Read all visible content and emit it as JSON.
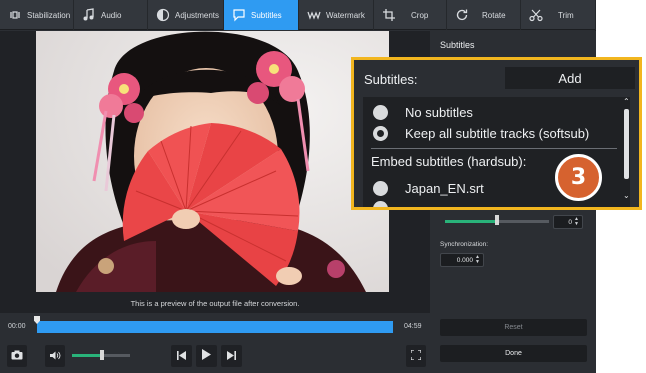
{
  "toolbar": {
    "tools": [
      {
        "label": "Stabilization",
        "icon": "stabilization-icon"
      },
      {
        "label": "Audio",
        "icon": "music-note-icon"
      },
      {
        "label": "Adjustments",
        "icon": "adjustments-icon"
      },
      {
        "label": "Subtitles",
        "icon": "speech-bubble-icon",
        "active": true
      },
      {
        "label": "Watermark",
        "icon": "watermark-icon"
      },
      {
        "label": "Crop",
        "icon": "crop-icon"
      },
      {
        "label": "Rotate",
        "icon": "rotate-icon"
      },
      {
        "label": "Trim",
        "icon": "scissors-icon"
      }
    ]
  },
  "preview": {
    "caption": "This is a preview of the output file after conversion."
  },
  "timeline": {
    "start": "00:00",
    "end": "04:59"
  },
  "controls": {
    "volume_level": 0.5
  },
  "panel": {
    "title": "Subtitles",
    "slider_level": 0.5,
    "slider_value": "0",
    "sync_label": "Synchronization:",
    "sync_value": "0.000",
    "reset_label": "Reset",
    "done_label": "Done"
  },
  "callout": {
    "subtitles_label": "Subtitles:",
    "add_label": "Add",
    "options": [
      {
        "label": "No subtitles",
        "selected": false
      },
      {
        "label": "Keep all subtitle tracks (softsub)",
        "selected": true
      }
    ],
    "embed_heading": "Embed subtitles (hardsub):",
    "embed_files": [
      "Japan_EN.srt"
    ],
    "step_number": "3"
  },
  "colors": {
    "accent": "#2f9bf2",
    "callout_border": "#f2b61f",
    "step_badge": "#d6622f",
    "slider_fill": "#29b37a"
  }
}
